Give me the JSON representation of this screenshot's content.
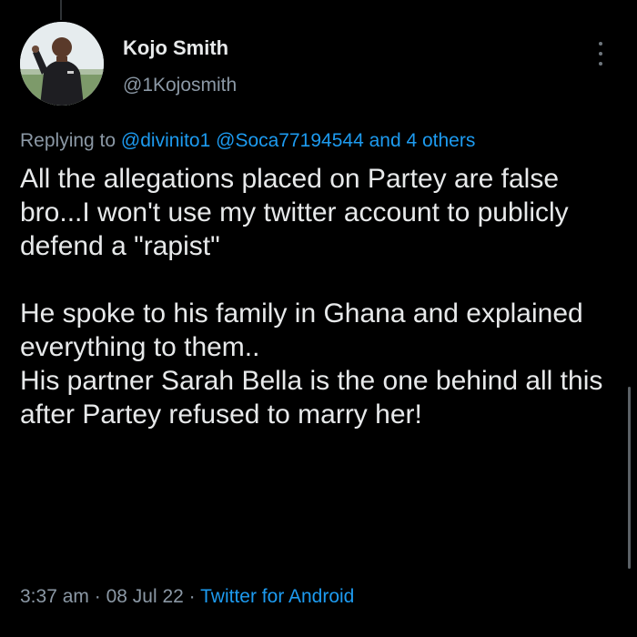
{
  "author": {
    "name": "Kojo Smith",
    "handle": "@1Kojosmith"
  },
  "reply": {
    "prefix": "Replying to",
    "mention_1": "@divinito1",
    "mention_2": "@Soca77194544",
    "others": "and 4 others"
  },
  "tweet": {
    "paragraph_1": "All the allegations placed on Partey are false bro...I won't use my twitter account to publicly defend a \"rapist\"",
    "paragraph_2_line_1": "He spoke to his family in Ghana and explained everything to them..",
    "paragraph_2_line_2": "His partner Sarah Bella is the one behind all this after Partey refused to marry her!"
  },
  "meta": {
    "time": "3:37 am",
    "separator": "·",
    "date": "08 Jul 22",
    "source": "Twitter for Android"
  },
  "icons": {
    "more": "more-vertical-icon"
  },
  "colors": {
    "background": "#000000",
    "text": "#e7e9ea",
    "secondary": "#8b98a5",
    "link": "#1d9bf0"
  }
}
